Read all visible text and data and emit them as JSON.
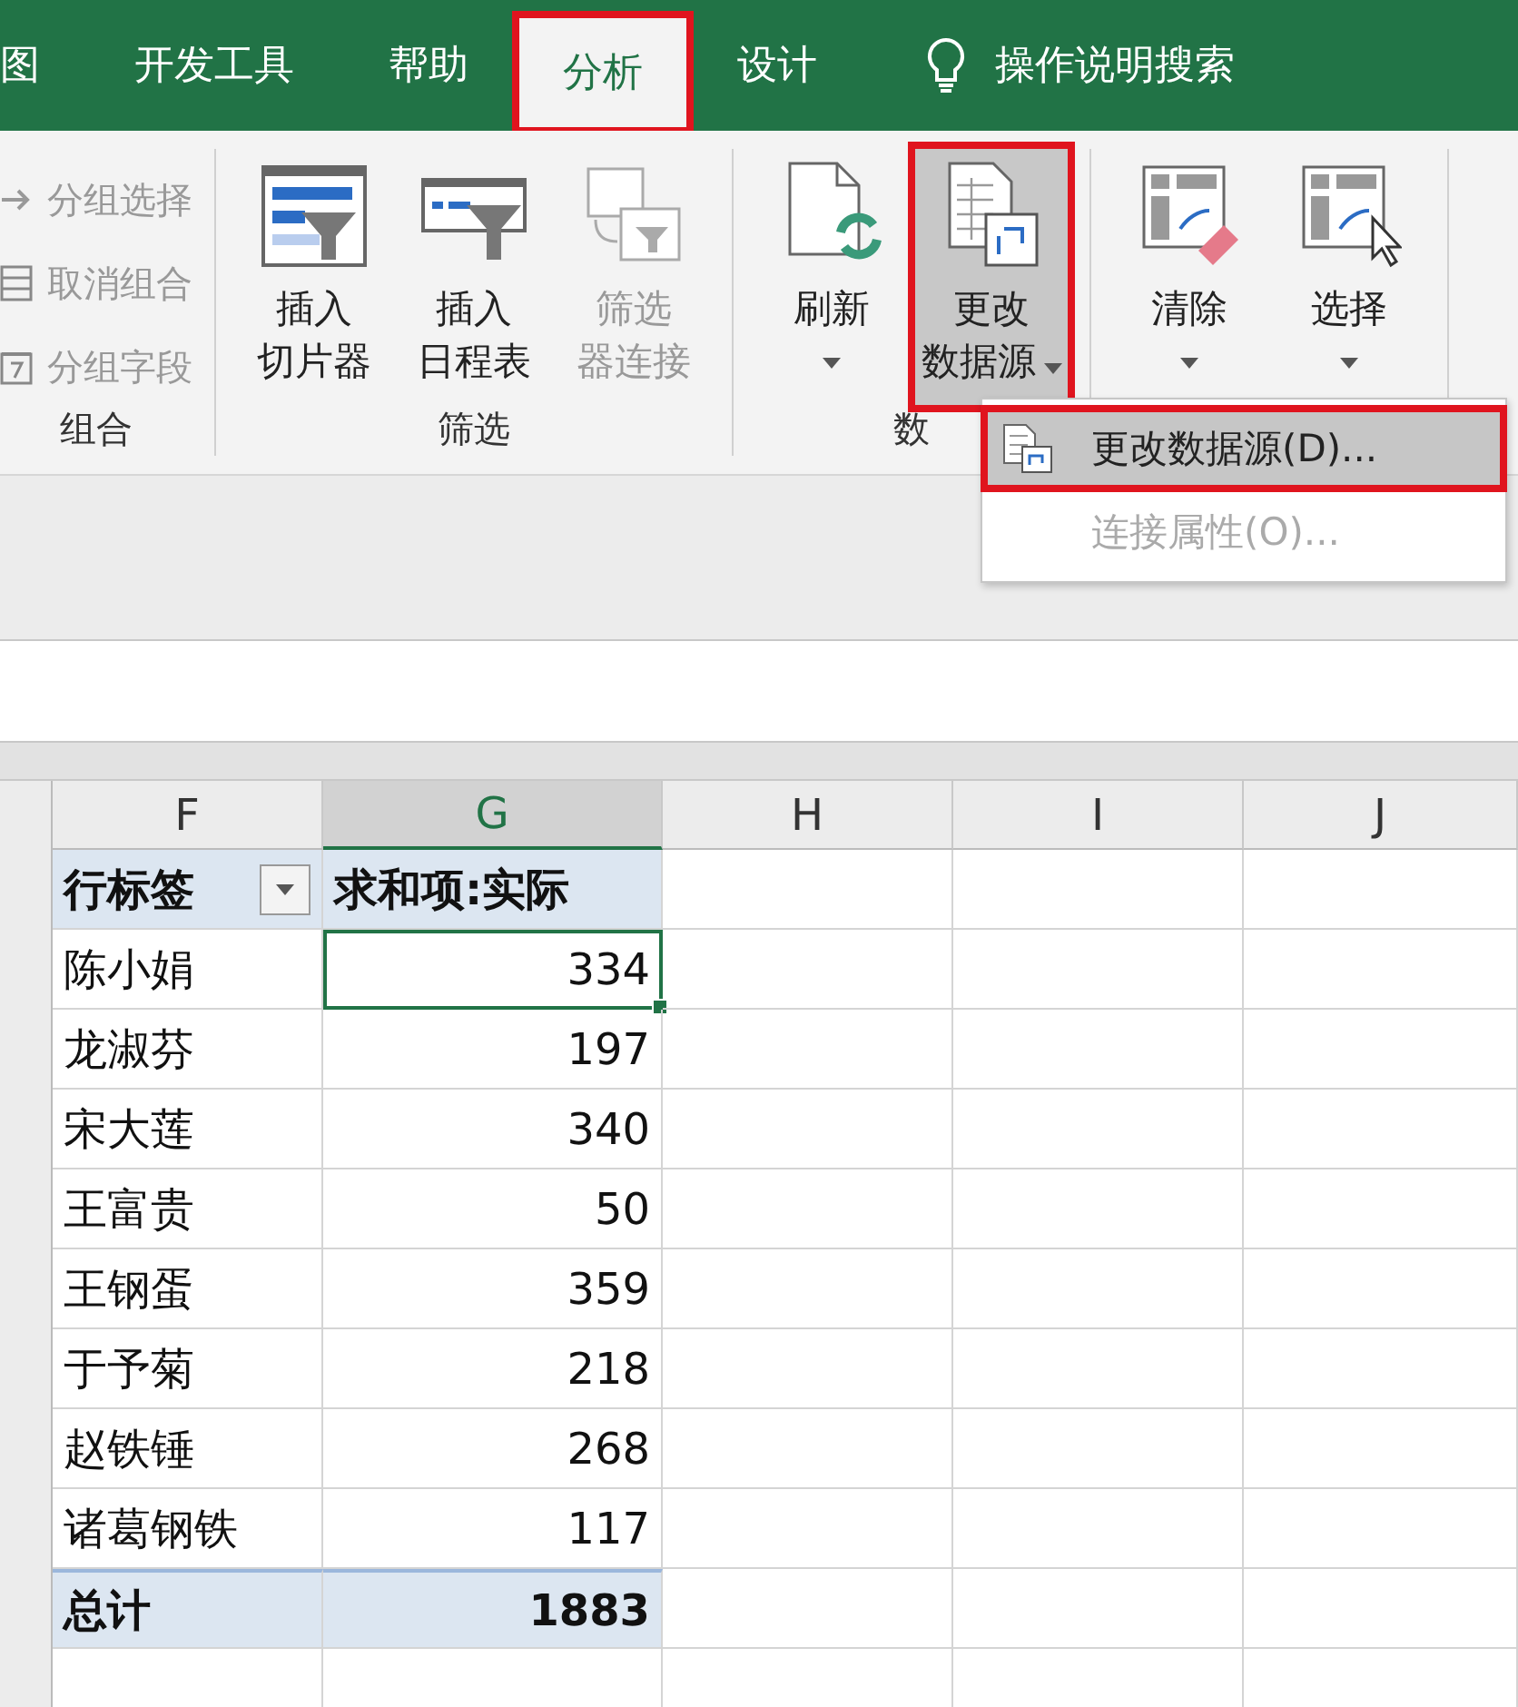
{
  "tabs": [
    {
      "label": "图",
      "selected": false,
      "highlighted": false
    },
    {
      "label": "开发工具",
      "selected": false,
      "highlighted": false
    },
    {
      "label": "帮助",
      "selected": false,
      "highlighted": false
    },
    {
      "label": "分析",
      "selected": true,
      "highlighted": true
    },
    {
      "label": "设计",
      "selected": false,
      "highlighted": false
    }
  ],
  "tell_me": {
    "label": "操作说明搜索"
  },
  "ribbon": {
    "groups": [
      {
        "label": "组合",
        "kind": "small",
        "items": [
          {
            "label": "分组选择",
            "kind": "arrow",
            "disabled": true
          },
          {
            "label": "取消组合",
            "kind": "ungroup",
            "disabled": true
          },
          {
            "label": "分组字段",
            "kind": "field",
            "disabled": true
          }
        ]
      },
      {
        "label": "筛选",
        "kind": "large",
        "items": [
          {
            "lines": [
              "插入",
              "切片器"
            ],
            "kind": "slicer",
            "disabled": false,
            "dropdown": false,
            "pressed": false,
            "highlighted": false
          },
          {
            "lines": [
              "插入",
              "日程表"
            ],
            "kind": "timeline",
            "disabled": false,
            "dropdown": false,
            "pressed": false,
            "highlighted": false
          },
          {
            "lines": [
              "筛选",
              "器连接"
            ],
            "kind": "connect",
            "disabled": true,
            "dropdown": false,
            "pressed": false,
            "highlighted": false
          }
        ]
      },
      {
        "label": "数",
        "kind": "large",
        "items": [
          {
            "lines": [
              "刷新"
            ],
            "kind": "refresh",
            "disabled": false,
            "dropdown": true,
            "pressed": false,
            "highlighted": false
          },
          {
            "lines": [
              "更改",
              "数据源"
            ],
            "kind": "source",
            "disabled": false,
            "dropdown": true,
            "pressed": true,
            "highlighted": true
          }
        ]
      },
      {
        "kind": "large",
        "items": [
          {
            "lines": [
              "清除"
            ],
            "kind": "clear",
            "disabled": false,
            "dropdown": true,
            "pressed": false,
            "highlighted": false
          },
          {
            "lines": [
              "选择"
            ],
            "kind": "select",
            "disabled": false,
            "dropdown": true,
            "pressed": false,
            "highlighted": false
          }
        ]
      }
    ]
  },
  "menu": {
    "items": [
      {
        "label": "更改数据源(D)...",
        "kind": "source",
        "selected": true,
        "highlighted": true,
        "disabled": false
      },
      {
        "label": "连接属性(O)...",
        "kind": "none",
        "selected": false,
        "highlighted": false,
        "disabled": true
      }
    ]
  },
  "sheet": {
    "columns": [
      {
        "label": "F",
        "selected": false
      },
      {
        "label": "G",
        "selected": true
      },
      {
        "label": "H",
        "selected": false
      },
      {
        "label": "I",
        "selected": false
      },
      {
        "label": "J",
        "selected": false
      }
    ],
    "pivot": {
      "header": [
        "行标签",
        "求和项:实际"
      ],
      "rows": [
        {
          "name": "陈小娟",
          "value": "334",
          "selected": true
        },
        {
          "name": "龙淑芬",
          "value": "197",
          "selected": false
        },
        {
          "name": "宋大莲",
          "value": "340",
          "selected": false
        },
        {
          "name": "王富贵",
          "value": "50",
          "selected": false
        },
        {
          "name": "王钢蛋",
          "value": "359",
          "selected": false
        },
        {
          "name": "于予菊",
          "value": "218",
          "selected": false
        },
        {
          "name": "赵铁锤",
          "value": "268",
          "selected": false
        },
        {
          "name": "诸葛钢铁",
          "value": "117",
          "selected": false
        }
      ],
      "total": {
        "label": "总计",
        "value": "1883"
      }
    }
  }
}
